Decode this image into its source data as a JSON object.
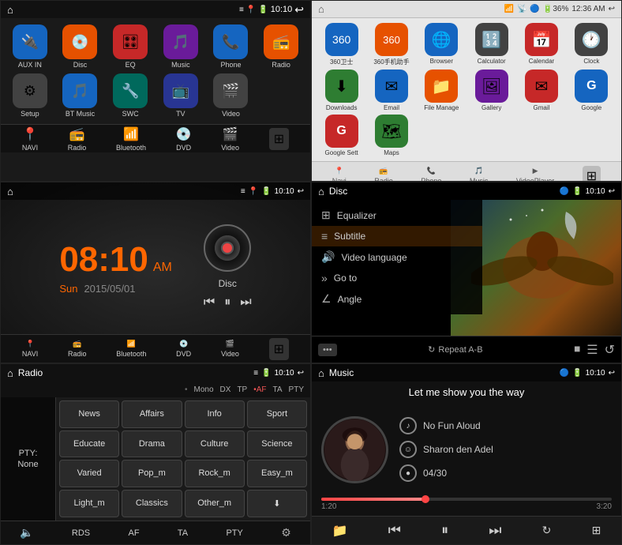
{
  "panel1": {
    "statusBar": {
      "time": "10:10",
      "home": "⌂"
    },
    "apps": [
      {
        "label": "AUX IN",
        "icon": "🔌",
        "color": "ic-blue"
      },
      {
        "label": "Disc",
        "icon": "💿",
        "color": "ic-orange"
      },
      {
        "label": "EQ",
        "icon": "🎛",
        "color": "ic-red"
      },
      {
        "label": "Music",
        "icon": "🎵",
        "color": "ic-purple"
      },
      {
        "label": "Phone",
        "icon": "📞",
        "color": "ic-blue"
      },
      {
        "label": "Radio",
        "icon": "📻",
        "color": "ic-orange"
      },
      {
        "label": "Setup",
        "icon": "⚙",
        "color": "ic-gray"
      },
      {
        "label": "BT Music",
        "icon": "🎵",
        "color": "ic-blue"
      },
      {
        "label": "SWC",
        "icon": "🔧",
        "color": "ic-teal"
      },
      {
        "label": "TV",
        "icon": "📺",
        "color": "ic-indigo"
      },
      {
        "label": "Video",
        "icon": "🎬",
        "color": "ic-gray"
      }
    ],
    "navItems": [
      {
        "label": "NAVI",
        "icon": "📍",
        "active": true
      },
      {
        "label": "Radio",
        "icon": "📻",
        "active": false
      },
      {
        "label": "Bluetooth",
        "icon": "📶",
        "active": false
      },
      {
        "label": "DVD",
        "icon": "💿",
        "active": false
      },
      {
        "label": "Video",
        "icon": "🎬",
        "active": false
      }
    ]
  },
  "panel2": {
    "statusBar": {
      "time": "12:36 AM",
      "title": ""
    },
    "apps": [
      {
        "label": "360卫士",
        "icon": "🛡",
        "color": "ic-blue"
      },
      {
        "label": "360手机助手",
        "icon": "📱",
        "color": "ic-orange"
      },
      {
        "label": "Browser",
        "icon": "🌐",
        "color": "ic-blue"
      },
      {
        "label": "Calculator",
        "icon": "🔢",
        "color": "ic-gray"
      },
      {
        "label": "Calendar",
        "icon": "📅",
        "color": "ic-red"
      },
      {
        "label": "Clock",
        "icon": "🕐",
        "color": "ic-gray"
      },
      {
        "label": "Downloads",
        "icon": "⬇",
        "color": "ic-green"
      },
      {
        "label": "Email",
        "icon": "✉",
        "color": "ic-blue"
      },
      {
        "label": "File Manage",
        "icon": "📁",
        "color": "ic-orange"
      },
      {
        "label": "Gallery",
        "icon": "🖼",
        "color": "ic-purple"
      },
      {
        "label": "Gmail",
        "icon": "✉",
        "color": "ic-red"
      },
      {
        "label": "Google",
        "icon": "G",
        "color": "ic-blue"
      },
      {
        "label": "Google Sett",
        "icon": "G",
        "color": "ic-red"
      },
      {
        "label": "Maps",
        "icon": "🗺",
        "color": "ic-green"
      },
      {
        "label": "Navi",
        "icon": "📍",
        "color": "ic-blue"
      },
      {
        "label": "Radio",
        "icon": "📻",
        "color": "ic-orange"
      },
      {
        "label": "Phone",
        "icon": "📞",
        "color": "ic-green"
      },
      {
        "label": "Music",
        "icon": "🎵",
        "color": "ic-orange"
      },
      {
        "label": "VideoPlayer",
        "icon": "▶",
        "color": "ic-teal"
      }
    ],
    "navItems": [
      "Navi",
      "Radio",
      "Phone",
      "Music",
      "VideoPlayer"
    ]
  },
  "panel3": {
    "statusBar": {
      "time": "10:10"
    },
    "time": "08:10",
    "ampm": "AM",
    "day": "Sun",
    "date": "2015/05/01",
    "discLabel": "Disc",
    "controls": [
      "⏮",
      "⏸",
      "⏭"
    ]
  },
  "panel4": {
    "statusBar": {
      "left": "Disc",
      "time": "10:10"
    },
    "menuItems": [
      {
        "icon": "⊞",
        "label": "Equalizer"
      },
      {
        "icon": "≡",
        "label": "Subtitle"
      },
      {
        "icon": "🔊",
        "label": "Video language"
      },
      {
        "icon": "»",
        "label": "Go to"
      },
      {
        "icon": "∠",
        "label": "Angle"
      },
      {
        "icon": "↻",
        "label": "Repeat A-B"
      }
    ]
  },
  "panel5": {
    "statusBar": {
      "left": "Radio",
      "time": "10:10"
    },
    "indicators": [
      "Mono",
      "DX",
      "TP",
      "AF",
      "TA",
      "PTY"
    ],
    "activeIndicator": "AF",
    "ptyLabel": "PTY:",
    "ptyValue": "None",
    "buttons": [
      "News",
      "Affairs",
      "Info",
      "Sport",
      "Educate",
      "Drama",
      "Culture",
      "Science",
      "Varied",
      "Pop_m",
      "Rock_m",
      "Easy_m",
      "Light_m",
      "Classics",
      "Other_m",
      "⬇"
    ],
    "bottomButtons": [
      "RDS",
      "AF",
      "TA",
      "PTY"
    ]
  },
  "panel6": {
    "statusBar": {
      "left": "Music",
      "time": "10:10"
    },
    "songTitle": "Let me show you the way",
    "artistRows": [
      {
        "icon": "◎",
        "text": "No Fun Aloud"
      },
      {
        "icon": "☺",
        "text": "Sharon den Adel"
      },
      {
        "icon": "●",
        "text": "04/30"
      }
    ],
    "progressCurrent": "1:20",
    "progressTotal": "3:20",
    "progressPercent": 36,
    "controls": [
      "⏮",
      "⏭",
      "⏸",
      "⏭",
      "↻",
      "⊞"
    ]
  }
}
